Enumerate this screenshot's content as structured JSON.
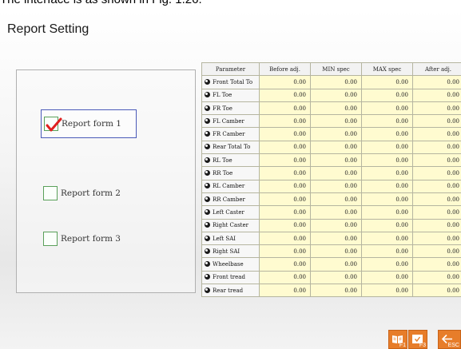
{
  "caption": "The interface is as shown in Fig. 1.26.",
  "title": "Report Setting",
  "report_forms": [
    {
      "label": "Report form 1",
      "checked": true
    },
    {
      "label": "Report form 2",
      "checked": false
    },
    {
      "label": "Report form 3",
      "checked": false
    }
  ],
  "table": {
    "headers": [
      "Parameter",
      "Before adj.",
      "MIN spec",
      "MAX spec",
      "After adj."
    ],
    "rows": [
      [
        "Front Total To",
        "0.00",
        "0.00",
        "0.00",
        "0.00"
      ],
      [
        "FL Toe",
        "0.00",
        "0.00",
        "0.00",
        "0.00"
      ],
      [
        "FR Toe",
        "0.00",
        "0.00",
        "0.00",
        "0.00"
      ],
      [
        "FL Camber",
        "0.00",
        "0.00",
        "0.00",
        "0.00"
      ],
      [
        "FR Camber",
        "0.00",
        "0.00",
        "0.00",
        "0.00"
      ],
      [
        "Rear Total To",
        "0.00",
        "0.00",
        "0.00",
        "0.00"
      ],
      [
        "RL Toe",
        "0.00",
        "0.00",
        "0.00",
        "0.00"
      ],
      [
        "RR Toe",
        "0.00",
        "0.00",
        "0.00",
        "0.00"
      ],
      [
        "RL Camber",
        "0.00",
        "0.00",
        "0.00",
        "0.00"
      ],
      [
        "RR Camber",
        "0.00",
        "0.00",
        "0.00",
        "0.00"
      ],
      [
        "Left Caster",
        "0.00",
        "0.00",
        "0.00",
        "0.00"
      ],
      [
        "Right Caster",
        "0.00",
        "0.00",
        "0.00",
        "0.00"
      ],
      [
        "Left SAI",
        "0.00",
        "0.00",
        "0.00",
        "0.00"
      ],
      [
        "Right SAI",
        "0.00",
        "0.00",
        "0.00",
        "0.00"
      ],
      [
        "Wheelbase",
        "0.00",
        "0.00",
        "0.00",
        "0.00"
      ],
      [
        "Front tread",
        "0.00",
        "0.00",
        "0.00",
        "0.00"
      ],
      [
        "Rear tread",
        "0.00",
        "0.00",
        "0.00",
        "0.00"
      ]
    ]
  },
  "function_keys": [
    {
      "key": "F1",
      "icon": "book-icon"
    },
    {
      "key": "F3",
      "icon": "checkmark-icon"
    },
    {
      "key": "ESC",
      "icon": "back-arrow-icon"
    }
  ],
  "colors": {
    "value_cell": "#fffbd0",
    "function_key": "#e77d2a",
    "checkmark": "#e02020",
    "selected_border": "#4a5ab8"
  }
}
